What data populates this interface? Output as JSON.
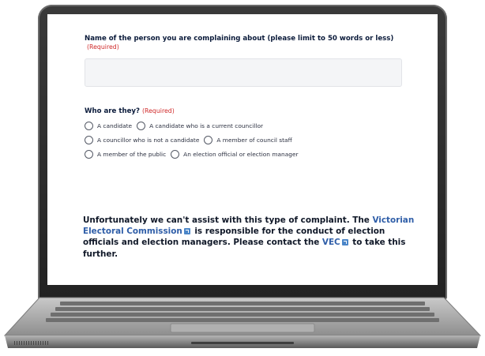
{
  "form": {
    "name_question": {
      "label": "Name of the person you are complaining about (please limit to 50 words or less)",
      "required": "(Required)",
      "value": ""
    },
    "who_question": {
      "label": "Who are they?",
      "required": "(Required)",
      "options": [
        "A candidate",
        "A candidate who is a current councillor",
        "A councillor who is not a candidate",
        "A member of council staff",
        "A member of the public",
        "An election official or election manager"
      ]
    }
  },
  "notice": {
    "part1": "Unfortunately we can't assist with this type of complaint. The ",
    "link1": "Victorian Electoral Commission",
    "part2": " is responsible for the conduct of election officials and election managers. Please contact the ",
    "link2": "VEC",
    "part3": " to take this further."
  },
  "colors": {
    "link": "#2f5ea8",
    "required": "#d02a2a",
    "external_icon": "#4b86c8"
  }
}
